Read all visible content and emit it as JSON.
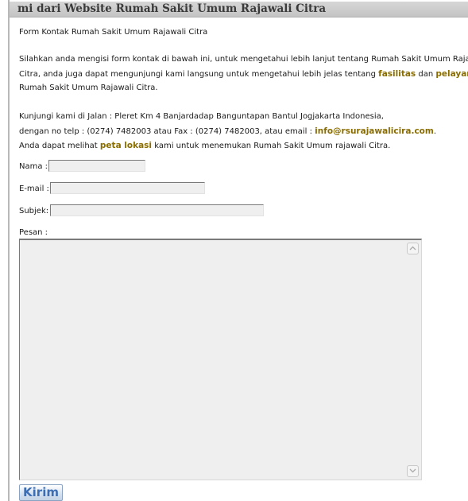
{
  "header": {
    "title": "mi dari Website Rumah Sakit Umum Rajawali Citra"
  },
  "intro": {
    "heading": "Form Kontak Rumah Sakit Umum Rajawali Citra",
    "para1_line1": "Silahkan anda mengisi form kontak di bawah ini, untuk mengetahui lebih lanjut tentang Rumah Sakit Umum Rajawali",
    "para1_line2_a": "Citra, anda juga dapat mengunjungi kami langsung untuk mengetahui lebih jelas tentang ",
    "link_fasilitas": "fasilitas",
    "para1_line2_b": " dan ",
    "link_pelayanan": "pelayanan",
    "para1_line3": "Rumah Sakit Umum Rajawali Citra."
  },
  "contact": {
    "address_line": "Kunjungi kami di Jalan : Pleret Km 4 Banjardadap Banguntapan Bantul Jogjakarta Indonesia,",
    "phone_line_a": "dengan no telp : (0274) 7482003 atau Fax : (0274) 7482003, atau email : ",
    "email_link": "info@rsurajawalicira.com",
    "phone_line_b": ".",
    "map_line_a": "Anda dapat melihat ",
    "map_link": "peta lokasi",
    "map_line_b": " kami untuk menemukan Rumah Sakit Umum rajawali Citra."
  },
  "form": {
    "nama_label": "Nama :",
    "nama_value": "",
    "email_label": "E-mail :",
    "email_value": "",
    "subjek_label": "Subjek:",
    "subjek_value": "",
    "pesan_label": "Pesan :",
    "pesan_value": "",
    "submit_label": "Kirim"
  },
  "icons": {
    "scroll_up": "chevron-up-icon",
    "scroll_down": "chevron-down-icon"
  },
  "colors": {
    "link": "#8a6d00",
    "button_text": "#3d6eb3",
    "title_bar": "#c8c8c8"
  }
}
